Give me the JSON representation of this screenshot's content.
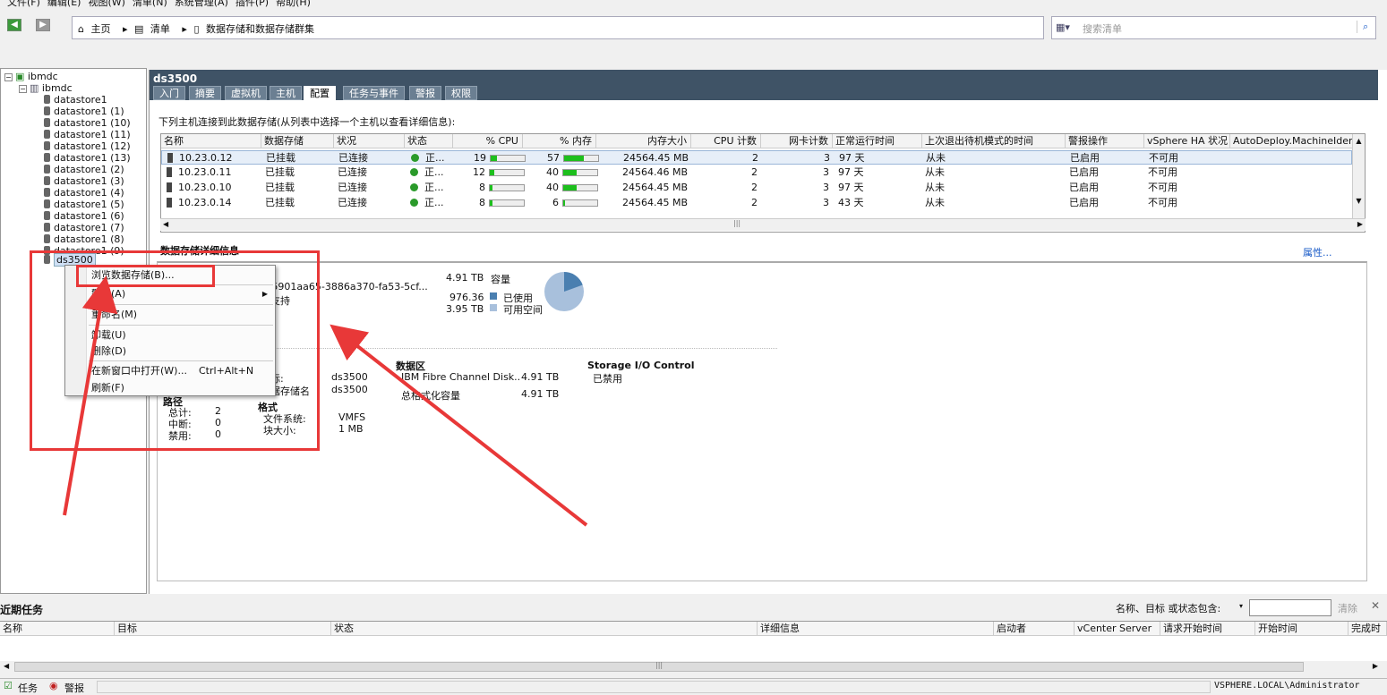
{
  "menu": [
    "文件(F)",
    "编辑(E)",
    "视图(W)",
    "清单(N)",
    "系统管理(A)",
    "插件(P)",
    "帮助(H)"
  ],
  "breadcrumb": {
    "home": "主页",
    "inventory": "清单",
    "current": "数据存储和数据存储群集"
  },
  "search": {
    "placeholder": "搜索清单"
  },
  "tree": {
    "root": "ibmdc",
    "dc": "ibmdc",
    "items": [
      "datastore1",
      "datastore1 (1)",
      "datastore1 (10)",
      "datastore1 (11)",
      "datastore1 (12)",
      "datastore1 (13)",
      "datastore1 (2)",
      "datastore1 (3)",
      "datastore1 (4)",
      "datastore1 (5)",
      "datastore1 (6)",
      "datastore1 (7)",
      "datastore1 (8)",
      "datastore1 (9)"
    ],
    "selected": "ds3500"
  },
  "main": {
    "title": "ds3500",
    "tabs": [
      "入门",
      "摘要",
      "虚拟机",
      "主机",
      "配置",
      "任务与事件",
      "警报",
      "权限"
    ],
    "active_tab": "配置",
    "host_instruction": "下列主机连接到此数据存储(从列表中选择一个主机以查看详细信息):",
    "columns": [
      "名称",
      "数据存储",
      "状况",
      "状态",
      "% CPU",
      "% 内存",
      "内存大小",
      "CPU 计数",
      "网卡计数",
      "正常运行时间",
      "上次退出待机模式的时间",
      "警报操作",
      "vSphere HA 状况",
      "AutoDeploy.MachineIdenti"
    ],
    "rows": [
      {
        "name": "10.23.0.12",
        "ds": "已挂载",
        "cond": "已连接",
        "state": "正...",
        "cpu": "19",
        "cpu_pct": 19,
        "mem": "57",
        "mem_pct": 57,
        "memsize": "24564.45 MB",
        "cpus": "2",
        "nics": "3",
        "uptime": "97 天",
        "standby": "从未",
        "alarm": "已启用",
        "ha": "不可用"
      },
      {
        "name": "10.23.0.11",
        "ds": "已挂载",
        "cond": "已连接",
        "state": "正...",
        "cpu": "12",
        "cpu_pct": 12,
        "mem": "40",
        "mem_pct": 40,
        "memsize": "24564.46 MB",
        "cpus": "2",
        "nics": "3",
        "uptime": "97 天",
        "standby": "从未",
        "alarm": "已启用",
        "ha": "不可用"
      },
      {
        "name": "10.23.0.10",
        "ds": "已挂载",
        "cond": "已连接",
        "state": "正...",
        "cpu": "8",
        "cpu_pct": 8,
        "mem": "40",
        "mem_pct": 40,
        "memsize": "24564.45 MB",
        "cpus": "2",
        "nics": "3",
        "uptime": "97 天",
        "standby": "从未",
        "alarm": "已启用",
        "ha": "不可用"
      },
      {
        "name": "10.23.0.14",
        "ds": "已挂载",
        "cond": "已连接",
        "state": "正...",
        "cpu": "8",
        "cpu_pct": 8,
        "mem": "6",
        "mem_pct": 6,
        "memsize": "24564.45 MB",
        "cpus": "2",
        "nics": "3",
        "uptime": "43 天",
        "standby": "从未",
        "alarm": "已启用",
        "ha": "不可用"
      }
    ]
  },
  "details": {
    "label": "数据存储详细信息",
    "properties_link": "属性...",
    "path_partial": "s/5901aa65-3886a370-fa53-5cf...",
    "support": "支持",
    "capacity_value": "4.91 TB",
    "capacity_label": "容量",
    "used_value": "976.36",
    "used_label": "已使用",
    "free_value": "3.95 TB",
    "free_label": "可用空间",
    "used_fraction": 0.195,
    "colors": {
      "used": "#4a7fb0",
      "free": "#a8c0dc"
    },
    "device_frag": "标:",
    "ds_name_frag": "据存储名",
    "device_value": "ds3500",
    "ds_name_value": "ds3500",
    "extent_header": "数据区",
    "extent_name": "IBM Fibre Channel Disk..",
    "extent_size": "4.91 TB",
    "total_formatted_label": "总格式化容量",
    "total_formatted_value": "4.91 TB",
    "sioc_header": "Storage I/O Control",
    "sioc_value": "已禁用",
    "path_header": "路径",
    "path_total_label": "总计:",
    "path_total": "2",
    "path_broken_label": "中断:",
    "path_broken": "0",
    "path_disabled_label": "禁用:",
    "path_disabled": "0",
    "format_header": "格式",
    "fs_label": "文件系统:",
    "fs_value": "VMFS",
    "block_label": "块大小:",
    "block_value": "1 MB"
  },
  "context_menu": [
    {
      "label": "浏览数据存储(B)..."
    },
    {
      "label": "警报(A)",
      "submenu": true
    },
    {
      "label": "重命名(M)"
    },
    {
      "label": "卸载(U)"
    },
    {
      "label": "删除(D)"
    },
    {
      "label": "在新窗口中打开(W)...",
      "shortcut": "Ctrl+Alt+N"
    },
    {
      "label": "刷新(F)"
    }
  ],
  "tasks": {
    "title": "近期任务",
    "filter_label": "名称、目标 或状态包含:",
    "clear": "清除",
    "columns": [
      "名称",
      "目标",
      "状态",
      "详细信息",
      "启动者",
      "vCenter Server",
      "请求开始时间",
      "开始时间",
      "完成时"
    ]
  },
  "status": {
    "tasks": "任务",
    "alarms": "警报",
    "user": "VSPHERE.LOCAL\\Administrator"
  }
}
